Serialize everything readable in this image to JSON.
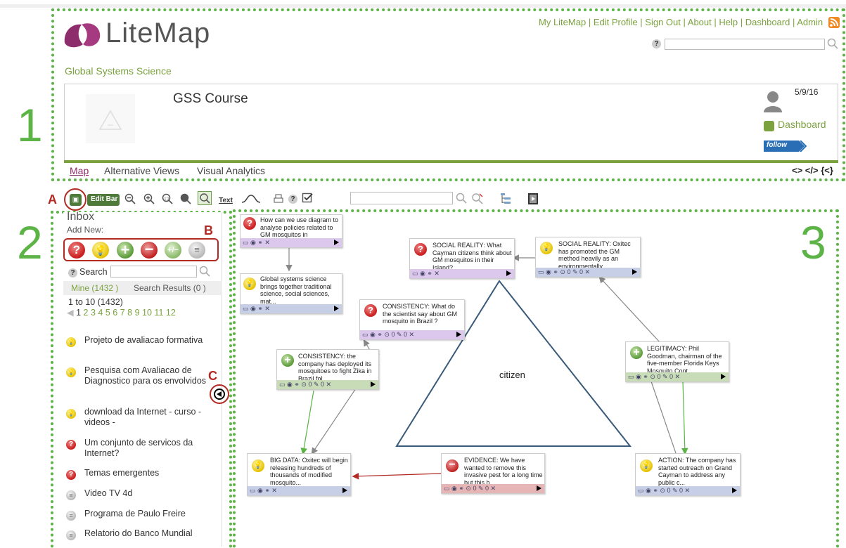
{
  "header": {
    "logo_text": "LiteMap",
    "links": [
      "My LiteMap",
      "Edit Profile",
      "Sign Out",
      "About",
      "Help",
      "Dashboard",
      "Admin"
    ],
    "search_value": "",
    "group_name": "Global Systems Science"
  },
  "map_info": {
    "title": "GSS Course",
    "date": "5/9/16",
    "dashboard_label": "Dashboard",
    "follow_label": "follow"
  },
  "tabs": [
    "Map",
    "Alternative Views",
    "Visual Analytics"
  ],
  "tab_icons_text": "<> </> {<}",
  "toolbar": {
    "edit_bar_label": "Edit Bar",
    "text_label": "Text",
    "search_value": ""
  },
  "annotations": {
    "region1": "1",
    "region2": "2",
    "region3": "3",
    "label_a": "A",
    "label_b": "B",
    "label_c": "C"
  },
  "inbox": {
    "title": "Inbox",
    "add_new_label": "Add New:",
    "search_label": "Search",
    "mine_label": "Mine (1432 )",
    "search_results_label": "Search Results (0 )",
    "range_label": "1 to 10 (1432)",
    "pages": [
      "1",
      "2",
      "3",
      "4",
      "5",
      "6",
      "7",
      "8",
      "9",
      "10",
      "11",
      "12"
    ],
    "items": [
      {
        "type": "idea",
        "label": "Projeto de avaliacao formativa"
      },
      {
        "type": "idea",
        "label": "Pesquisa com Avaliacao de Diagnostico para os envolvidos"
      },
      {
        "type": "idea",
        "label": "download da Internet - curso - videos -"
      },
      {
        "type": "question",
        "label": "Um conjunto de servicos da Internet?"
      },
      {
        "type": "question",
        "label": "Temas emergentes"
      },
      {
        "type": "reference",
        "label": "Video TV 4d"
      },
      {
        "type": "reference",
        "label": "Programa de Paulo Freire"
      },
      {
        "type": "reference",
        "label": "Relatorio do Banco Mundial"
      }
    ]
  },
  "map": {
    "center_label": "citizen",
    "nodes": [
      {
        "id": "n1",
        "type": "question",
        "bar": "purple",
        "text": "How can we use diagram to analyse  policies related to GM mosquitos in Caymman? ..."
      },
      {
        "id": "n2",
        "type": "idea",
        "bar": "blue",
        "text": "Global systems science brings together traditional science, social sciences, mat..."
      },
      {
        "id": "n3",
        "type": "question",
        "bar": "purple",
        "text": "CONSISTENCY: What do the scientist say about GM mosquito in Brazil ?"
      },
      {
        "id": "n4",
        "type": "question",
        "bar": "purple",
        "text": "SOCIAL REALITY: What Cayman citizens think about GM mosquitos in their Island? ..."
      },
      {
        "id": "n5",
        "type": "idea",
        "bar": "blue",
        "text": "SOCIAL REALITY: Oxitec has promoted the GM method heavily as an environmentally ..."
      },
      {
        "id": "n6",
        "type": "pro",
        "bar": "green",
        "text": "CONSISTENCY: the company has deployed its mosquitoes to fight Zika in Brazil fol..."
      },
      {
        "id": "n7",
        "type": "pro",
        "bar": "green",
        "text": "LEGITIMACY: Phil Goodman, chairman of the five-member Florida Keys Mosquito Cont..."
      },
      {
        "id": "n8",
        "type": "idea",
        "bar": "blue",
        "text": "BIG DATA: Oxitec will begin releasing hundreds of thousands of modified mosquito..."
      },
      {
        "id": "n9",
        "type": "con",
        "bar": "red",
        "text": "EVIDENCE: We have wanted to remove this invasive pest for a long time but this h..."
      },
      {
        "id": "n10",
        "type": "idea",
        "bar": "blue",
        "text": "ACTION: The company has started outreach on Grand Cayman to address any public c..."
      }
    ],
    "bar_counts": {
      "a": "0",
      "b": "0"
    }
  }
}
